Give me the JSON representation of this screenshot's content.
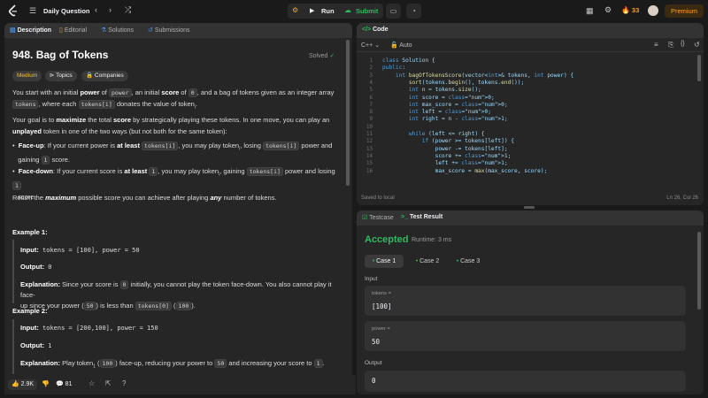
{
  "nav": {
    "title": "Daily Question",
    "run": "Run",
    "submit": "Submit",
    "streak": "33",
    "premium": "Premium"
  },
  "desc_tabs": [
    "Description",
    "Editorial",
    "Solutions",
    "Submissions"
  ],
  "problem": {
    "title": "948. Bag of Tokens",
    "status": "Solved",
    "difficulty": "Medium",
    "tags": [
      "Topics",
      "Companies"
    ],
    "p1a": "You start with an initial ",
    "p1b": "power",
    "p1c": " of ",
    "p1d": "power",
    "p1e": ", an initial ",
    "p1f": "score",
    "p1g": " of ",
    "p1h": "0",
    "p1i": ", and a bag of tokens given as an integer array",
    "p1j": "tokens",
    "p1k": ", where each ",
    "p1l": "tokens[i]",
    "p1m": " donates the value of token",
    "p1n": "i",
    "p1o": ".",
    "p2a": "Your goal is to ",
    "p2b": "maximize",
    "p2c": " the total ",
    "p2d": "score",
    "p2e": " by strategically playing these tokens. In one move, you can play an",
    "p2f": "unplayed",
    "p2g": " token in one of the two ways (but not both for the same token):",
    "b1a": "Face-up",
    "b1b": ": If your current power is ",
    "b1c": "at least",
    "b1d": "tokens[i]",
    "b1e": ", you may play token",
    "b1f": "i",
    "b1g": ", losing ",
    "b1h": "tokens[i]",
    "b1i": " power and",
    "b1j": "gaining ",
    "b1k": "1",
    "b1l": " score.",
    "b2a": "Face-down",
    "b2b": ": If your current score is ",
    "b2c": "at least",
    "b2d": "1",
    "b2e": ", you may play token",
    "b2f": "i",
    "b2g": ", gaining ",
    "b2h": "tokens[i]",
    "b2i": " power and losing ",
    "b2j": "1",
    "b2k": "score.",
    "r1": "Return the ",
    "r2": "maximum",
    "r3": " possible score you can achieve after playing ",
    "r4": "any",
    "r5": " number of tokens.",
    "ex1_title": "Example 1:",
    "ex1_input_label": "Input:",
    "ex1_input": " tokens = [100], power = 50",
    "ex1_output_label": "Output:",
    "ex1_output": " 0",
    "ex1_expl_label": "Explanation:",
    "ex1_expl_a": " Since your score is ",
    "ex1_expl_b": "0",
    "ex1_expl_c": " initially, you cannot play the token face-down. You also cannot play it face-",
    "ex1_expl_d": "up since your power (",
    "ex1_expl_e": "50",
    "ex1_expl_f": ") is less than ",
    "ex1_expl_g": "tokens[0]",
    "ex1_expl_h": "100",
    "ex2_title": "Example 2:",
    "ex2_input_label": "Input:",
    "ex2_input": " tokens = [200,100], power = 150",
    "ex2_output_label": "Output:",
    "ex2_output": " 1",
    "ex2_expl_label": "Explanation:",
    "ex2_expl_a": " Play token",
    "ex2_expl_b": "1",
    "ex2_expl_c": "100",
    "ex2_expl_d": " face-up, reducing your power to ",
    "ex2_expl_e": "50",
    "ex2_expl_f": " and increasing your score to ",
    "ex2_expl_g": "1"
  },
  "desc_footer": {
    "likes": "2.9K",
    "comments": "81"
  },
  "code": {
    "tab": "Code",
    "language": "C++",
    "mode": "Auto",
    "saved": "Saved to local",
    "cursor": "Ln 26, Col 26",
    "lines": [
      "class Solution {",
      "public:",
      "    int bagOfTokensScore(vector<int>& tokens, int power) {",
      "        sort(tokens.begin(), tokens.end());",
      "        int n = tokens.size();",
      "        int score = 0;",
      "        int max_score = 0;",
      "        int left = 0;",
      "        int right = n - 1;",
      "",
      "        while (left <= right) {",
      "            if (power >= tokens[left]) {",
      "                power -= tokens[left];",
      "                score += 1;",
      "                left += 1;",
      "                max_score = max(max_score, score);"
    ]
  },
  "result": {
    "tab_testcase": "Testcase",
    "tab_result": "Test Result",
    "verdict": "Accepted",
    "runtime": "Runtime: 3 ms",
    "cases": [
      "Case 1",
      "Case 2",
      "Case 3"
    ],
    "input_label": "Input",
    "tokens_label": "tokens =",
    "tokens_value": "[100]",
    "power_label": "power =",
    "power_value": "50",
    "output_label": "Output",
    "output_value": "0"
  },
  "colors": {
    "accent": "#ffa116",
    "easy": "#00b8a3",
    "medium": "#ffc01e",
    "accepted": "#2cbb5d"
  }
}
